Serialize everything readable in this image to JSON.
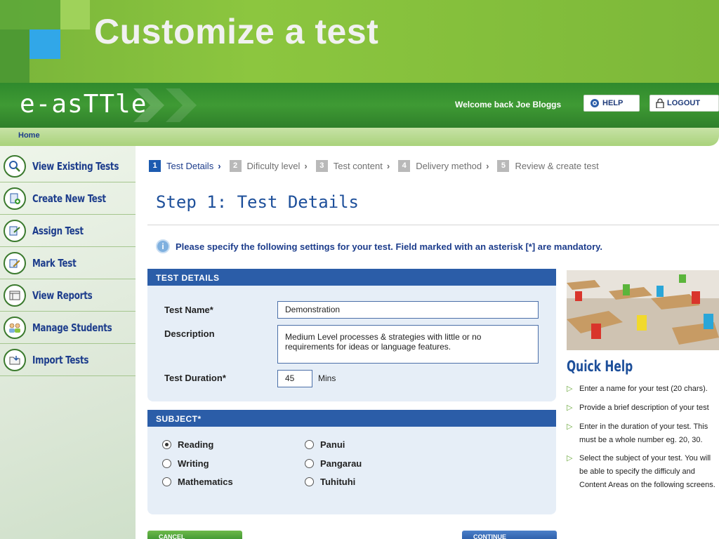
{
  "slide": {
    "title": "Customize a test"
  },
  "app": {
    "logo": "e-asTTle",
    "welcome": "Welcome back Joe Bloggs",
    "help_label": "HELP",
    "logout_label": "LOGOUT",
    "breadcrumb": "Home"
  },
  "sidebar": {
    "items": [
      {
        "label": "View Existing Tests",
        "icon": "magnifier-icon"
      },
      {
        "label": "Create New Test",
        "icon": "add-test-icon"
      },
      {
        "label": "Assign Test",
        "icon": "assign-icon"
      },
      {
        "label": "Mark Test",
        "icon": "pencil-icon"
      },
      {
        "label": "View Reports",
        "icon": "report-icon"
      },
      {
        "label": "Manage Students",
        "icon": "students-icon"
      },
      {
        "label": "Import Tests",
        "icon": "import-icon"
      }
    ]
  },
  "steps": [
    {
      "num": "1",
      "label": "Test Details"
    },
    {
      "num": "2",
      "label": "Dificulty level"
    },
    {
      "num": "3",
      "label": "Test content"
    },
    {
      "num": "4",
      "label": "Delivery method"
    },
    {
      "num": "5",
      "label": "Review & create test"
    }
  ],
  "main": {
    "title": "Step 1: Test Details",
    "notice": "Please specify the following settings for your test. Field marked with an asterisk [*] are mandatory."
  },
  "details": {
    "heading": "TEST DETAILS",
    "name_label": "Test Name*",
    "name_value": "Demonstration",
    "description_label": "Description",
    "description_value": "Medium Level processes & strategies with little or no requirements for ideas or language features.",
    "duration_label": "Test Duration*",
    "duration_value": "45",
    "duration_unit": "Mins"
  },
  "subject": {
    "heading": "SUBJECT*",
    "options": [
      {
        "label": "Reading",
        "selected": true
      },
      {
        "label": "Writing",
        "selected": false
      },
      {
        "label": "Mathematics",
        "selected": false
      },
      {
        "label": "Panui",
        "selected": false
      },
      {
        "label": "Pangarau",
        "selected": false
      },
      {
        "label": "Tuhituhi",
        "selected": false
      }
    ]
  },
  "quick_help": {
    "title": "Quick Help",
    "items": [
      "Enter a name for your test (20 chars).",
      "Provide a brief description of your test",
      "Enter in the duration of your test. This must be a whole number eg. 20, 30.",
      "Select the subject of your test. You will be able to specify the difficuly and Content Areas on the following screens."
    ]
  },
  "buttons": {
    "cancel": "CANCEL",
    "continue": "CONTINUE"
  },
  "colors": {
    "brand_green": "#3f9a34",
    "brand_blue": "#2b5da8",
    "link_blue": "#1d3d8c"
  }
}
